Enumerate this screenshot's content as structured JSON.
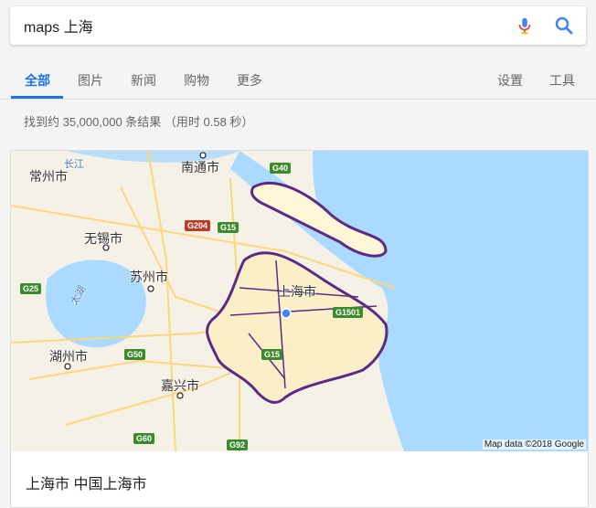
{
  "search": {
    "query": "maps 上海"
  },
  "tabs": [
    {
      "label": "全部"
    },
    {
      "label": "图片"
    },
    {
      "label": "新闻"
    },
    {
      "label": "购物"
    },
    {
      "label": "更多"
    }
  ],
  "tools": {
    "settings": "设置",
    "tools": "工具"
  },
  "result_stats": "找到约 35,000,000 条结果 （用时 0.58 秒）",
  "map": {
    "labels": {
      "changzhou": "常州市",
      "nantong": "南通市",
      "wuxi": "无锡市",
      "suzhou": "苏州市",
      "shanghai": "上海市",
      "huzhou": "湖州市",
      "jiaxing": "嘉兴市",
      "changjiang": "长江",
      "taihu": "太湖"
    },
    "shields": {
      "g40": "G40",
      "g204": "G204",
      "g15a": "G15",
      "g25": "G25",
      "g1501": "G1501",
      "g50": "G50",
      "g15b": "G15",
      "g60": "G60",
      "g92": "G92"
    },
    "attribution": "Map data ©2018 Google",
    "colors": {
      "water": "#aadaff",
      "land": "#f5f1e6",
      "boundary": "#5b2a86",
      "road": "#fcd77a"
    }
  },
  "card": {
    "title": "上海市 中国上海市"
  }
}
